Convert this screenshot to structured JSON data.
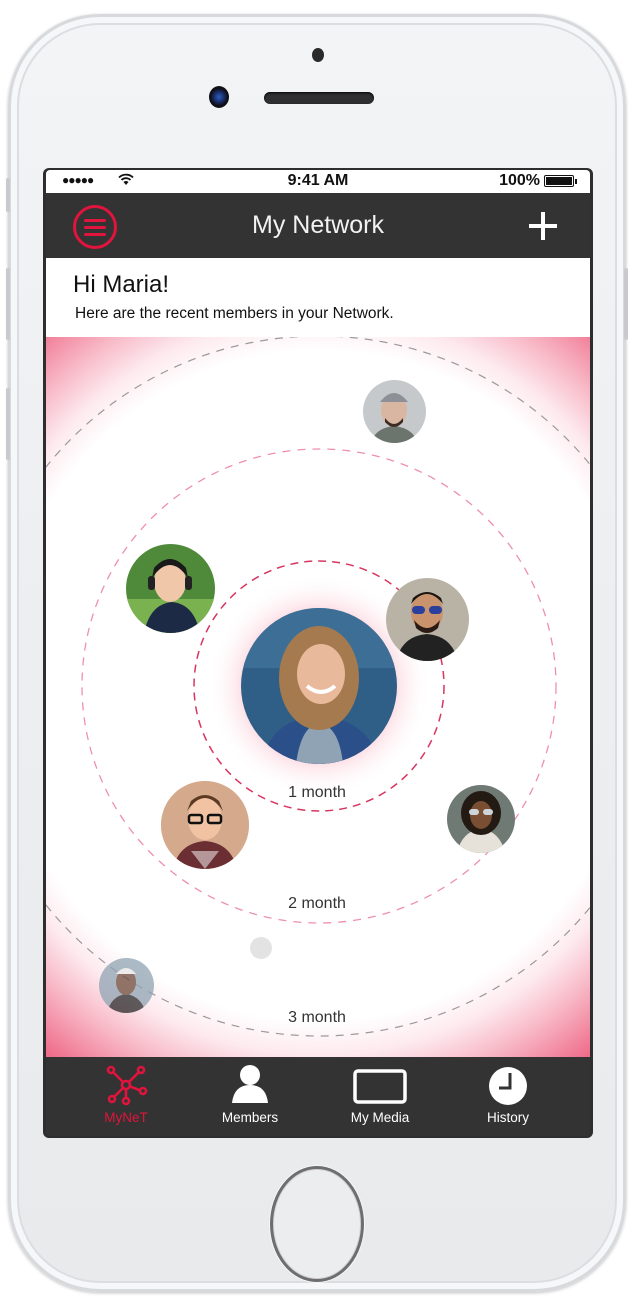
{
  "status_bar": {
    "signal": "●●●●●",
    "time": "9:41 AM",
    "battery_percent": "100%"
  },
  "header": {
    "title": "My Network",
    "menu_icon": "hamburger-menu-icon",
    "add_icon": "plus-icon"
  },
  "greeting": {
    "title": "Hi Maria!",
    "subtitle": "Here are the recent members in your Network."
  },
  "network": {
    "rings": [
      {
        "label": "1 month",
        "color": "#d8345f"
      },
      {
        "label": "2 month",
        "color": "#ee8fb0"
      },
      {
        "label": "3 month",
        "color": "#9a9a9a"
      }
    ],
    "center_member": {
      "name": "Maria",
      "photo": "smiling woman in denim jacket"
    },
    "members": [
      {
        "ring": "3 month",
        "photo": "bearded man in grey beanie"
      },
      {
        "ring": "2 month",
        "photo": "woman with headphones"
      },
      {
        "ring": "1 month",
        "photo": "man with blue sunglasses"
      },
      {
        "ring": "2 month",
        "photo": "young man with glasses against brick wall"
      },
      {
        "ring": "2 month",
        "photo": "woman with curly hair and mirrored sunglasses"
      },
      {
        "ring": "3 month",
        "photo": "woman with short bleached hair"
      }
    ],
    "placeholder_dot": "empty member slot"
  },
  "colors": {
    "accent": "#e0143c",
    "bar_bg": "#333333",
    "glow": "#ef6d8b"
  },
  "tabbar": {
    "items": [
      {
        "label": "MyNeT",
        "icon": "network-icon",
        "active": true
      },
      {
        "label": "Members",
        "icon": "person-icon",
        "active": false
      },
      {
        "label": "My Media",
        "icon": "media-frame-icon",
        "active": false
      },
      {
        "label": "History",
        "icon": "clock-icon",
        "active": false
      }
    ]
  }
}
